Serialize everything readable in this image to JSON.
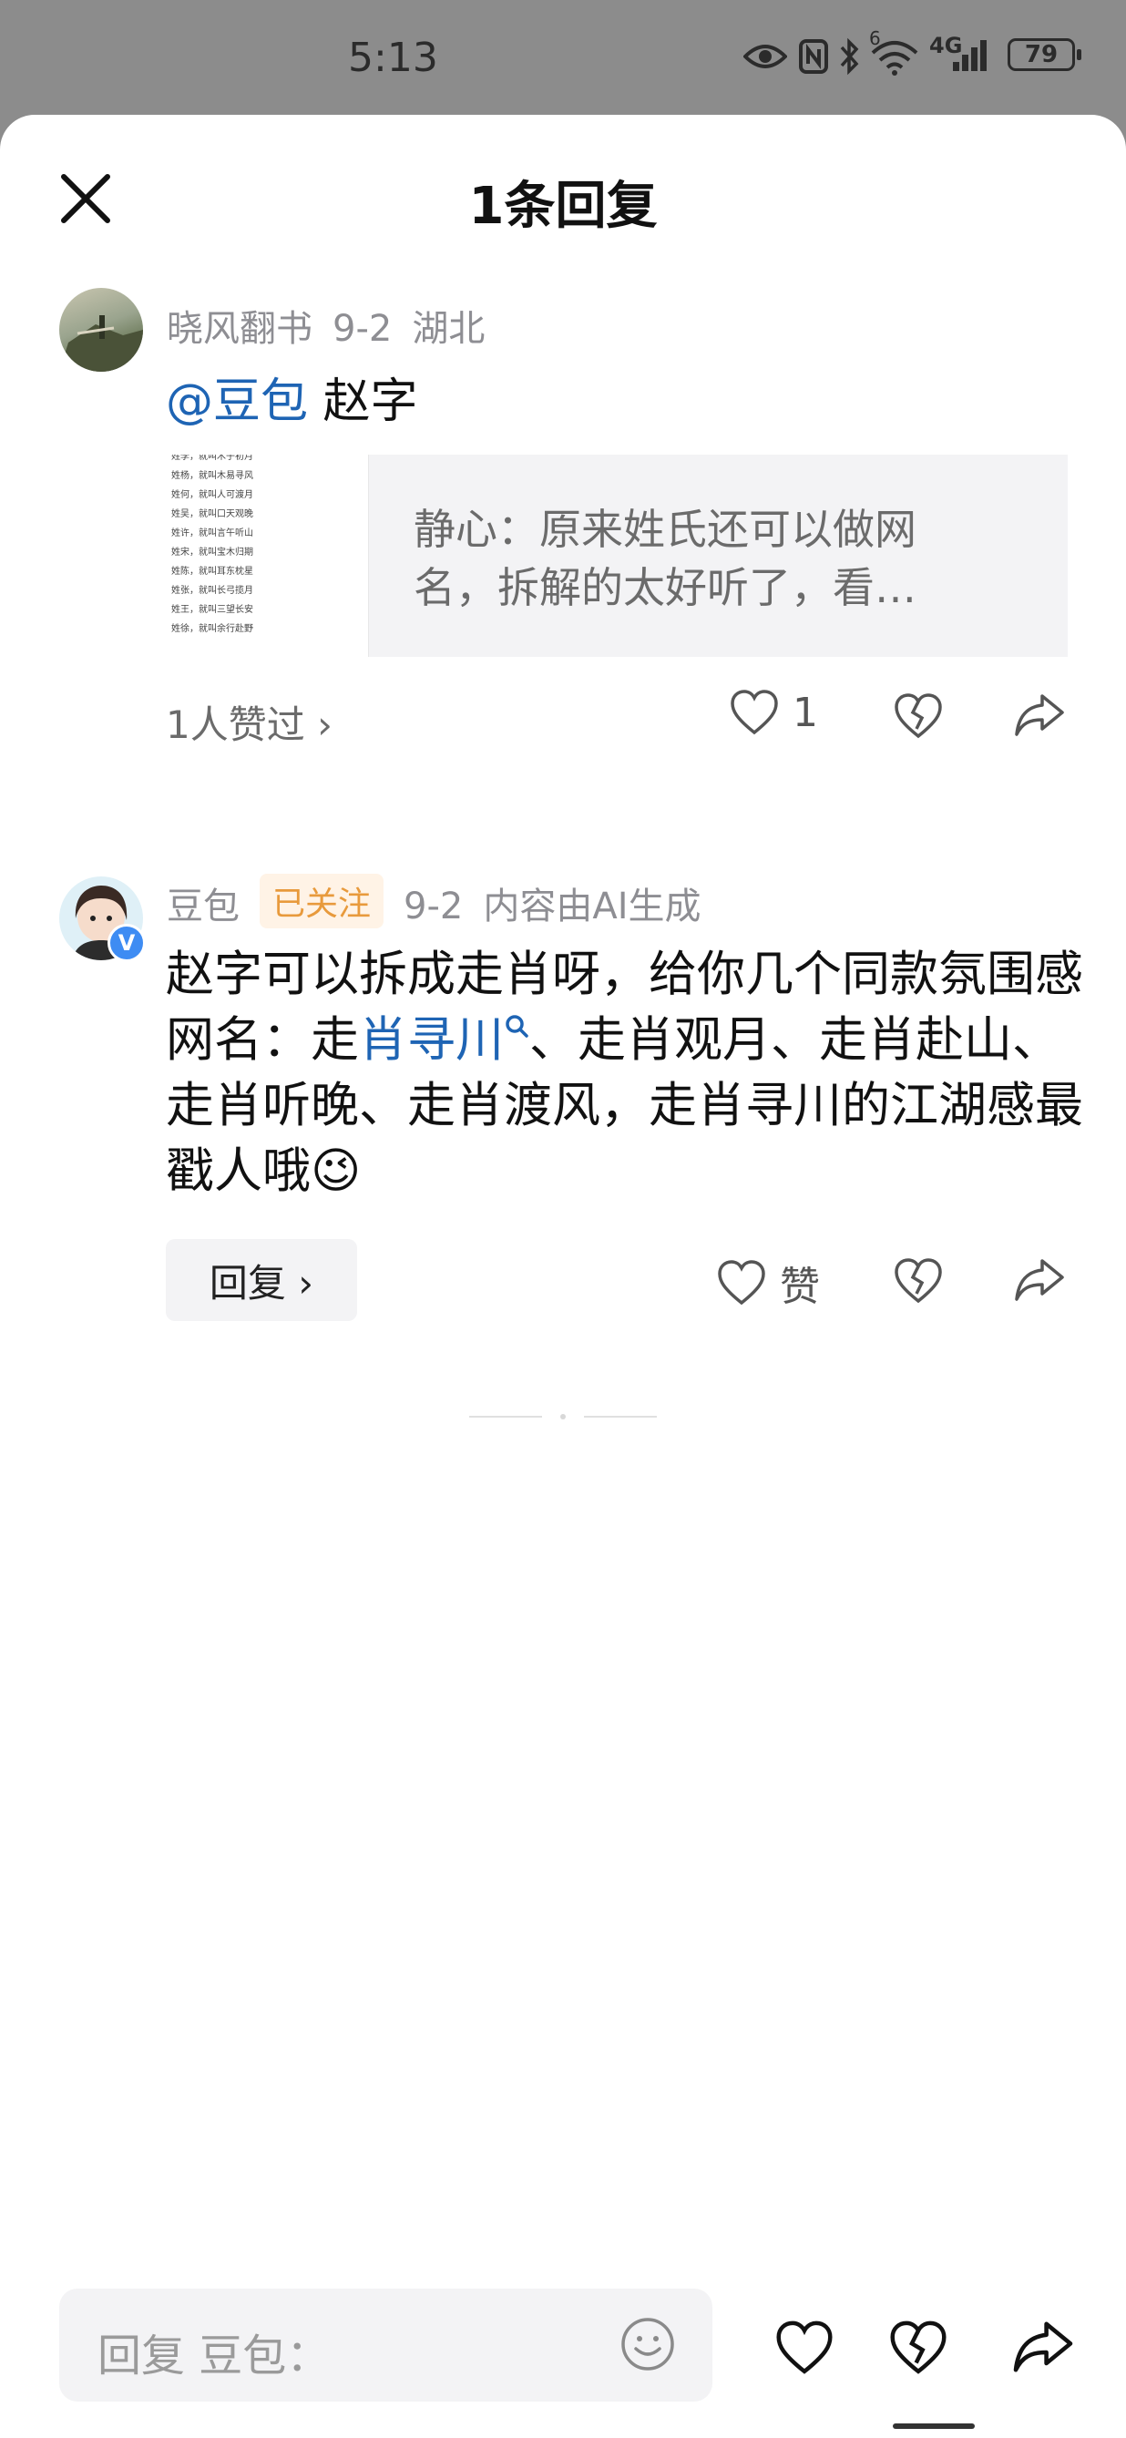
{
  "status_bar": {
    "time": "5:13",
    "network": "4G",
    "signal_sup": "6",
    "battery": "79"
  },
  "sheet": {
    "title": "1条回复"
  },
  "comment": {
    "author": "晓风翻书",
    "date": "9-2",
    "location": "湖北",
    "mention": "@豆包",
    "text": "赵字",
    "quote": "静心：原来姓氏还可以做网名，拆解的太好听了，看…",
    "quote_thumb_lines": [
      "姓李，就叫木子初月",
      "姓杨，就叫木易寻风",
      "姓何，就叫人可渡月",
      "姓吴，就叫口天观晚",
      "姓许，就叫言午听山",
      "姓宋，就叫宝木归期",
      "姓陈，就叫耳东枕星",
      "姓张，就叫长弓揽月",
      "姓王，就叫三望长安",
      "姓徐，就叫余行赴野"
    ],
    "likes_summary": "1人赞过 ›",
    "like_count": "1"
  },
  "reply": {
    "author": "豆包",
    "follow_badge": "已关注",
    "date": "9-2",
    "ai_note": "内容由AI生成",
    "avatar_badge": "V",
    "text_before": "赵字可以拆成走肖呀，给你几个同款氛围感网名：走",
    "text_link": "肖寻川",
    "text_after": "、走肖观月、走肖赴山、走肖听晚、走肖渡风，走肖寻川的江湖感最戳人哦",
    "emoji": "😉",
    "reply_button": "回复 ›",
    "like_label": "赞"
  },
  "bottom_bar": {
    "placeholder": "回复 豆包："
  },
  "colors": {
    "link": "#1e64b4",
    "follow_badge_bg": "#fff3e6",
    "follow_badge_text": "#e89a3c"
  },
  "icons": [
    "close-icon",
    "heart-icon",
    "broken-heart-icon",
    "share-icon",
    "search-icon",
    "emoji-icon"
  ]
}
